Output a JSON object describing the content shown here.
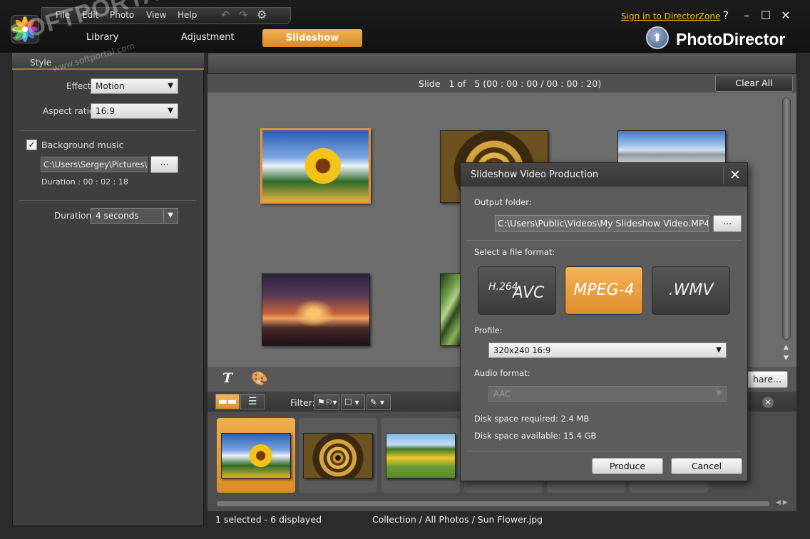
{
  "menu": {
    "file": "File",
    "edit": "Edit",
    "photo": "Photo",
    "view": "View",
    "help": "Help"
  },
  "nav": {
    "library": "Library",
    "adjustment": "Adjustment",
    "slideshow": "Slideshow"
  },
  "account": {
    "signin": "Sign in to DirectorZone"
  },
  "window_controls": {
    "help": "?",
    "minimize": "–",
    "maximize": "☐",
    "close": "✕"
  },
  "brand": {
    "name": "PhotoDirector"
  },
  "style_panel": {
    "header": "Style",
    "effect_label": "Effect",
    "effect_value": "Motion",
    "aspect_label": "Aspect ratio",
    "aspect_value": "16:9",
    "bg_music_label": "Background music",
    "bg_music_checked": true,
    "bg_music_path": "C:\\Users\\Sergey\\Pictures\\...",
    "browse": "...",
    "music_duration": "Duration : 00 : 02 : 18",
    "duration_label": "Duration",
    "duration_value": "4 seconds"
  },
  "slide_bar": {
    "label": "Slide",
    "position": "1 of",
    "count": "5 (00 : 00 : 00 / 00 : 00 : 20)",
    "clear_all": "Clear All"
  },
  "toolbar": {
    "share": "hare..."
  },
  "filter": {
    "label": "Filter:"
  },
  "status": {
    "selection": "1 selected - 6 displayed",
    "path": "Collection / All Photos / Sun Flower.jpg"
  },
  "dialog": {
    "title": "Slideshow Video Production",
    "close": "✕",
    "output_label": "Output folder:",
    "output_path": "C:\\Users\\Public\\Videos\\My Slideshow Video.MP4",
    "browse": "...",
    "format_label": "Select a file format:",
    "formats": [
      {
        "sup": "H.264",
        "main": "AVC"
      },
      {
        "main": "MPEG-4",
        "selected": true
      },
      {
        "main": ".WMV"
      }
    ],
    "profile_label": "Profile:",
    "profile_value": "320x240 16:9",
    "audio_label": "Audio format:",
    "audio_value": "AAC",
    "disk_required": "Disk space required: 2.4 MB",
    "disk_available": "Disk space available: 15.4 GB",
    "produce": "Produce",
    "cancel": "Cancel"
  },
  "watermark": {
    "text": "SOFTPORTAL",
    "url": "www.softportal.com"
  },
  "colors": {
    "accent": "#e8a03c",
    "signin": "#f5c400"
  }
}
